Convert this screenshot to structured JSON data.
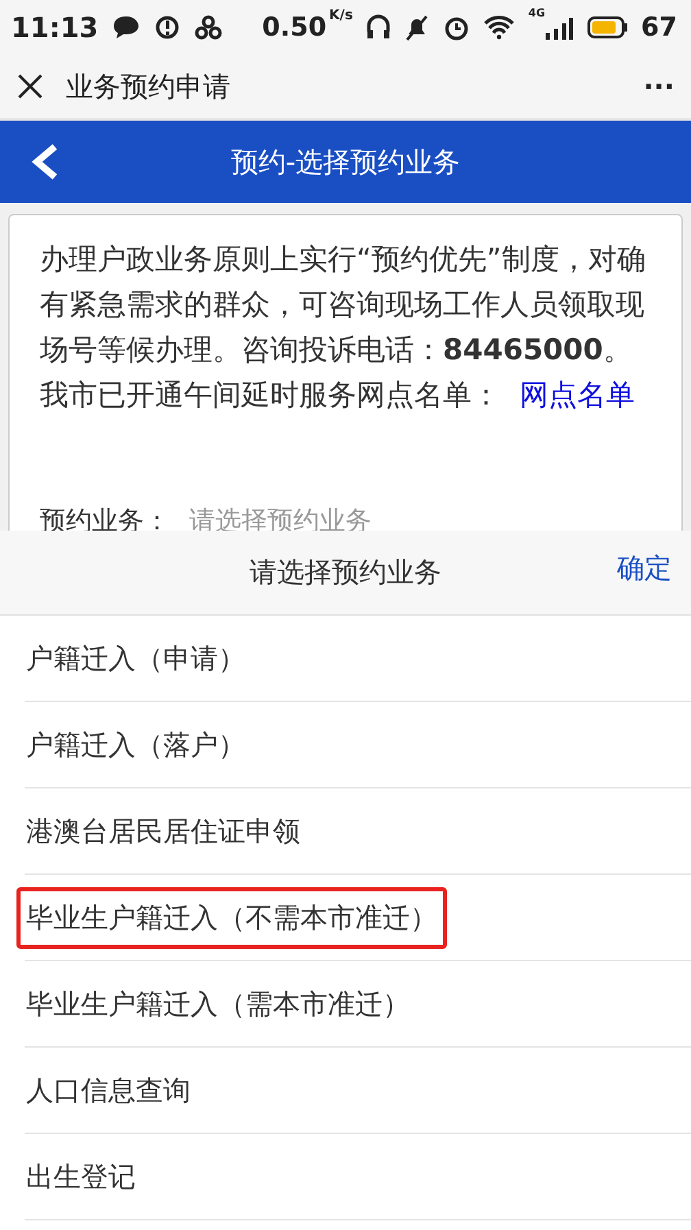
{
  "status_bar": {
    "time": "11:13",
    "net_speed": "0.50",
    "net_unit": "K/s",
    "network": "4G",
    "battery": "67"
  },
  "title_bar": {
    "title": "业务预约申请",
    "more": "···"
  },
  "header": {
    "title": "预约-选择预约业务"
  },
  "notice": {
    "text": "办理户政业务原则上实行“预约优先”制度，对确有紧急需求的群众，可咨询现场工作人员领取现场号等候办理。咨询投诉电话：**84465000**。我市已开通午间延时服务网点名单：",
    "link": "网点名单"
  },
  "form": {
    "label": "预约业务：",
    "placeholder": "请选择预约业务"
  },
  "picker": {
    "title": "请选择预约业务",
    "confirm": "确定",
    "options": [
      {
        "label": "户籍迁入（申请）",
        "highlighted": false
      },
      {
        "label": "户籍迁入（落户）",
        "highlighted": false
      },
      {
        "label": "港澳台居民居住证申领",
        "highlighted": false
      },
      {
        "label": "毕业生户籍迁入（不需本市准迁）",
        "highlighted": true
      },
      {
        "label": "毕业生户籍迁入（需本市准迁）",
        "highlighted": false
      },
      {
        "label": "人口信息查询",
        "highlighted": false
      },
      {
        "label": "出生登记",
        "highlighted": false
      }
    ]
  }
}
